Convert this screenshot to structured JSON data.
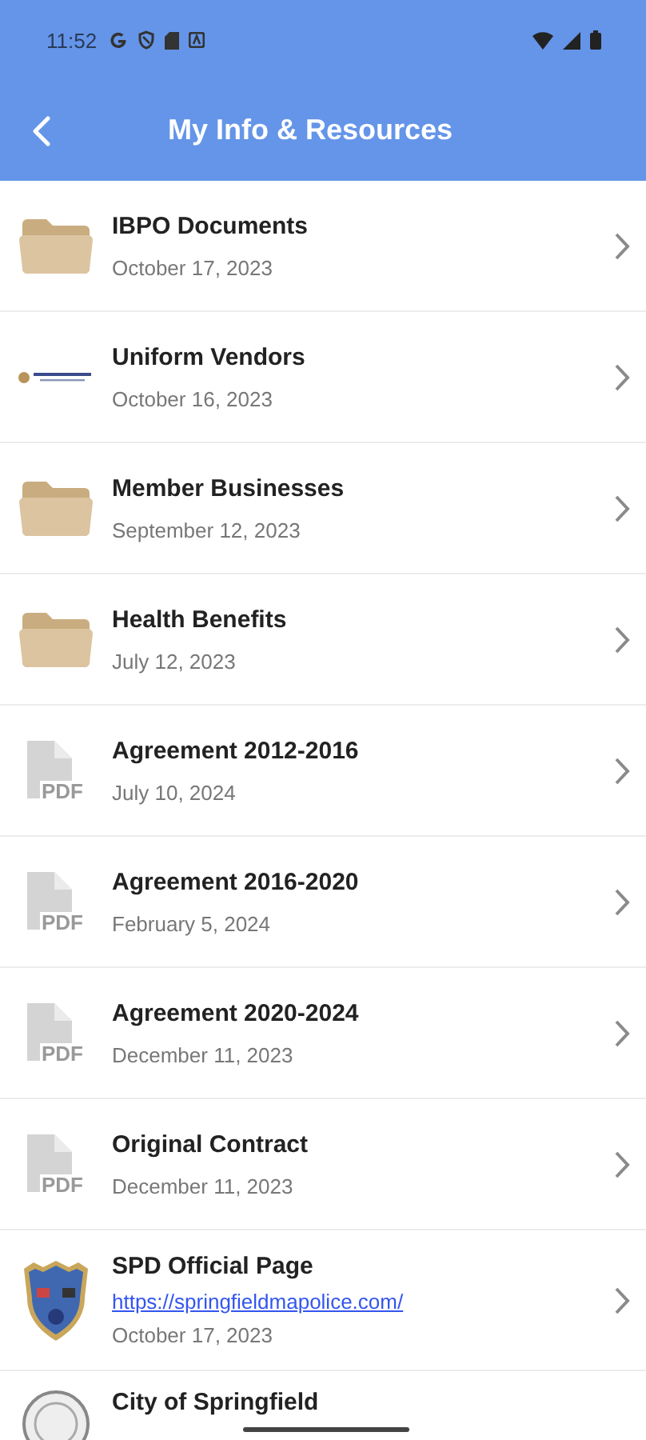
{
  "status_bar": {
    "time": "11:52"
  },
  "header": {
    "title": "My Info & Resources"
  },
  "items": [
    {
      "kind": "folder",
      "title": "IBPO Documents",
      "date": "October 17, 2023"
    },
    {
      "kind": "logo",
      "title": "Uniform Vendors",
      "date": "October 16, 2023"
    },
    {
      "kind": "folder",
      "title": "Member Businesses",
      "date": "September 12, 2023"
    },
    {
      "kind": "folder",
      "title": "Health Benefits",
      "date": "July 12, 2023"
    },
    {
      "kind": "pdf",
      "icon_text": "PDF",
      "title": "Agreement 2012-2016",
      "date": "July 10, 2024"
    },
    {
      "kind": "pdf",
      "icon_text": "PDF",
      "title": "Agreement 2016-2020",
      "date": "February 5, 2024"
    },
    {
      "kind": "pdf",
      "icon_text": "PDF",
      "title": "Agreement 2020-2024",
      "date": "December 11, 2023"
    },
    {
      "kind": "pdf",
      "icon_text": "PDF",
      "title": "Original Contract",
      "date": "December 11, 2023"
    },
    {
      "kind": "badge",
      "title": "SPD Official Page",
      "link": "https://springfieldmapolice.com/",
      "date": "October 17, 2023"
    },
    {
      "kind": "seal",
      "title": "City of Springfield"
    }
  ]
}
